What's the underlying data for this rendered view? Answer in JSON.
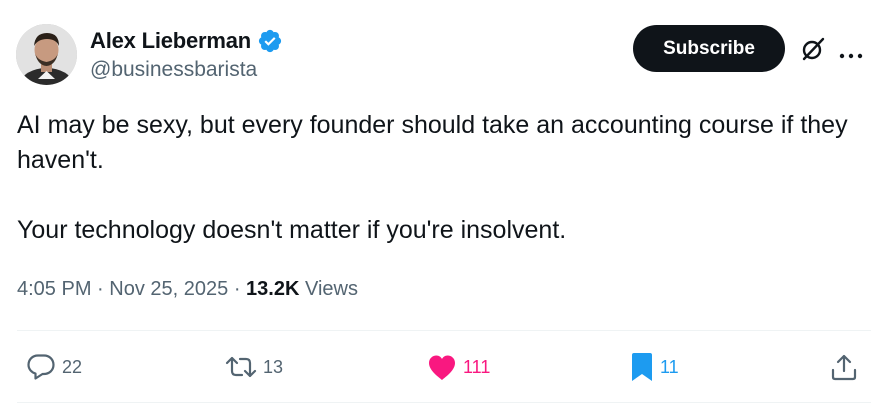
{
  "author": {
    "display_name": "Alex Lieberman",
    "handle": "@businessbarista",
    "verified": true,
    "verified_color": "#1d9bf0"
  },
  "header_actions": {
    "subscribe_label": "Subscribe",
    "grok_icon": "grok-icon",
    "more_icon": "more-icon"
  },
  "tweet": {
    "paragraph_1": "AI may be sexy, but every founder should take an accounting course if they haven't.",
    "paragraph_2": "Your technology doesn't matter if you're insolvent."
  },
  "meta": {
    "time": "4:05 PM",
    "separator": "·",
    "date": "Nov 25, 2025",
    "views_count": "13.2K",
    "views_label": "Views"
  },
  "actions": {
    "replies": "22",
    "retweets": "13",
    "likes": "111",
    "bookmarks": "11",
    "like_color": "#f91880",
    "bookmark_color": "#1d9bf0",
    "muted_color": "#536471"
  }
}
